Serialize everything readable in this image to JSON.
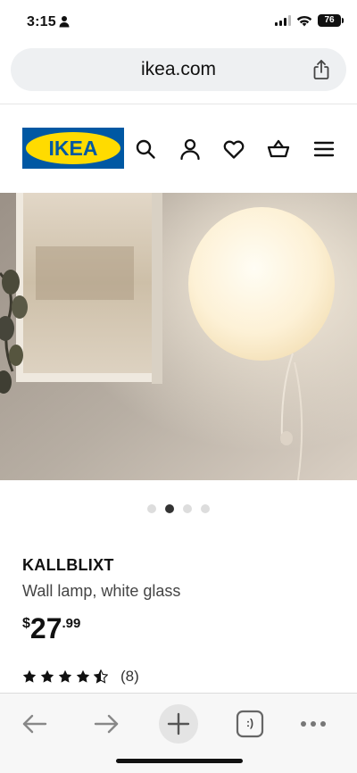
{
  "status_bar": {
    "time": "3:15",
    "battery": "76"
  },
  "browser": {
    "url": "ikea.com"
  },
  "header": {
    "logo_text": "IKEA",
    "icons": [
      "search-icon",
      "account-icon",
      "favorites-icon",
      "cart-icon",
      "menu-icon"
    ]
  },
  "carousel": {
    "total": 4,
    "active_index": 1
  },
  "product": {
    "name": "KALLBLIXT",
    "description": "Wall lamp, white glass",
    "price": {
      "currency": "$",
      "integer": "27",
      "decimal": ".99"
    },
    "rating": {
      "stars": 4.5,
      "max": 5,
      "count_label": "(8)"
    }
  },
  "toolbar": {
    "tabs_label": ":)",
    "icons": [
      "back-arrow-icon",
      "forward-arrow-icon",
      "new-tab-icon",
      "tabs-icon",
      "more-icon"
    ]
  },
  "colors": {
    "ikea_blue": "#0058a3",
    "ikea_yellow": "#ffdb00"
  }
}
